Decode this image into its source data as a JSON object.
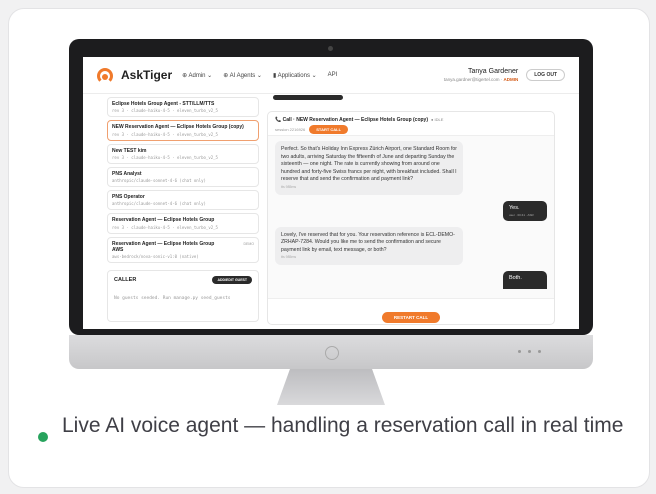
{
  "header": {
    "brand": "AskTiger",
    "nav": [
      "⊕ Admin ⌄",
      "⊕ AI Agents ⌄",
      "▮ Applications ⌄",
      "API"
    ],
    "user_name": "Tanya Gardener",
    "user_email": "tanya.gardner@tigertel.com · ",
    "user_role": "ADMIN",
    "logout": "LOG OUT"
  },
  "agents": [
    {
      "title": "Eclipse Hotels Group Agent - STT/LLM/TTS",
      "meta": "rev 3 · claude-haiku-4-5 · eleven_turbo_v2_5",
      "active": false
    },
    {
      "title": "NEW Reservation Agent — Eclipse Hotels Group (copy)",
      "meta": "rev 3 · claude-haiku-4-5 · eleven_turbo_v2_5",
      "active": true
    },
    {
      "title": "New TEST kim",
      "meta": "rev 3 · claude-haiku-4-5 · eleven_turbo_v2_5",
      "active": false
    },
    {
      "title": "PNS Analyst",
      "meta": "anthropic/claude-sonnet-4-6 (chat only)",
      "active": false
    },
    {
      "title": "PNS Operator",
      "meta": "anthropic/claude-sonnet-4-6 (chat only)",
      "active": false
    },
    {
      "title": "Reservation Agent — Eclipse Hotels Group",
      "meta": "rev 3 · claude-haiku-4-5 · eleven_turbo_v2_5",
      "active": false
    },
    {
      "title": "Reservation Agent — Eclipse Hotels Group AWS",
      "meta": "aws-bedrock/nova-sonic-v1:0 (native)",
      "active": false,
      "tag": "DEMO"
    }
  ],
  "caller": {
    "title": "CALLER",
    "button": "ADD/EDIT GUEST",
    "note": "No guests seeded. Run manage.py seed_guests"
  },
  "call": {
    "title": "📞 Call · NEW Reservation Agent — Eclipse Hotels Group (copy)",
    "tag": "● IDLE",
    "session": "session 2216926",
    "start": "START CALL",
    "restart": "RESTART CALL"
  },
  "messages": [
    {
      "role": "agent",
      "text": "Perfect. So that's Holiday Inn Express Zürich Airport, one Standard Room for two adults, arriving Saturday the fifteenth of June and departing Sunday the sixteenth — one night. The rate is currently showing from around one hundred and forty-five Swiss francs per night, with breakfast included. Shall I reserve that and send the confirmation and payment link?",
      "ts": "tts 985ms"
    },
    {
      "role": "user",
      "text": "Yes.",
      "ts": "user · 00:41 · ASR"
    },
    {
      "role": "agent",
      "text": "Lovely, I've reserved that for you. Your reservation reference is ECL-DEMO-ZRHAP-7284. Would you like me to send the confirmation and secure payment link by email, text message, or both?",
      "ts": "tts 985ms"
    },
    {
      "role": "user",
      "text": "Both.",
      "ts": ""
    }
  ],
  "caption": "Live AI voice agent — handling a reservation call in real time",
  "colors": {
    "accent": "#f07a2b",
    "bullet": "#27a35d"
  }
}
